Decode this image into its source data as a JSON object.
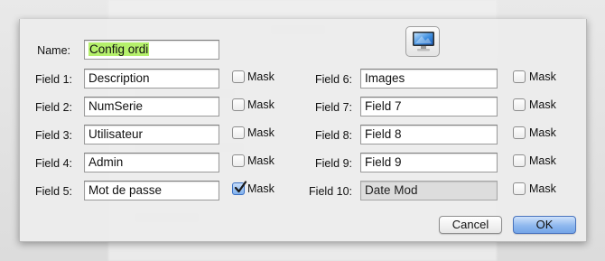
{
  "dialog": {
    "name_label": "Name:",
    "name_value": "Config ordi",
    "mask_label": "Mask",
    "left_fields": [
      {
        "label": "Field 1:",
        "value": "Description",
        "masked": false
      },
      {
        "label": "Field 2:",
        "value": "NumSerie",
        "masked": false
      },
      {
        "label": "Field 3:",
        "value": "Utilisateur",
        "masked": false
      },
      {
        "label": "Field 4:",
        "value": "Admin",
        "masked": false
      },
      {
        "label": "Field 5:",
        "value": "Mot de passe",
        "masked": true
      }
    ],
    "right_fields": [
      {
        "label": "Field 6:",
        "value": "Images",
        "masked": false
      },
      {
        "label": "Field 7:",
        "value": "Field 7",
        "masked": false
      },
      {
        "label": "Field 8:",
        "value": "Field 8",
        "masked": false
      },
      {
        "label": "Field 9:",
        "value": "Field 9",
        "masked": false
      },
      {
        "label": "Field 10:",
        "value": "Date Mod",
        "masked": false,
        "disabled": true
      }
    ],
    "icon": "computer-monitor-icon",
    "cancel_label": "Cancel",
    "ok_label": "OK"
  },
  "colors": {
    "name_highlight": "#b5f06c",
    "default_button": "#74a5e8",
    "checkbox_checked": "#3a6fc2"
  }
}
